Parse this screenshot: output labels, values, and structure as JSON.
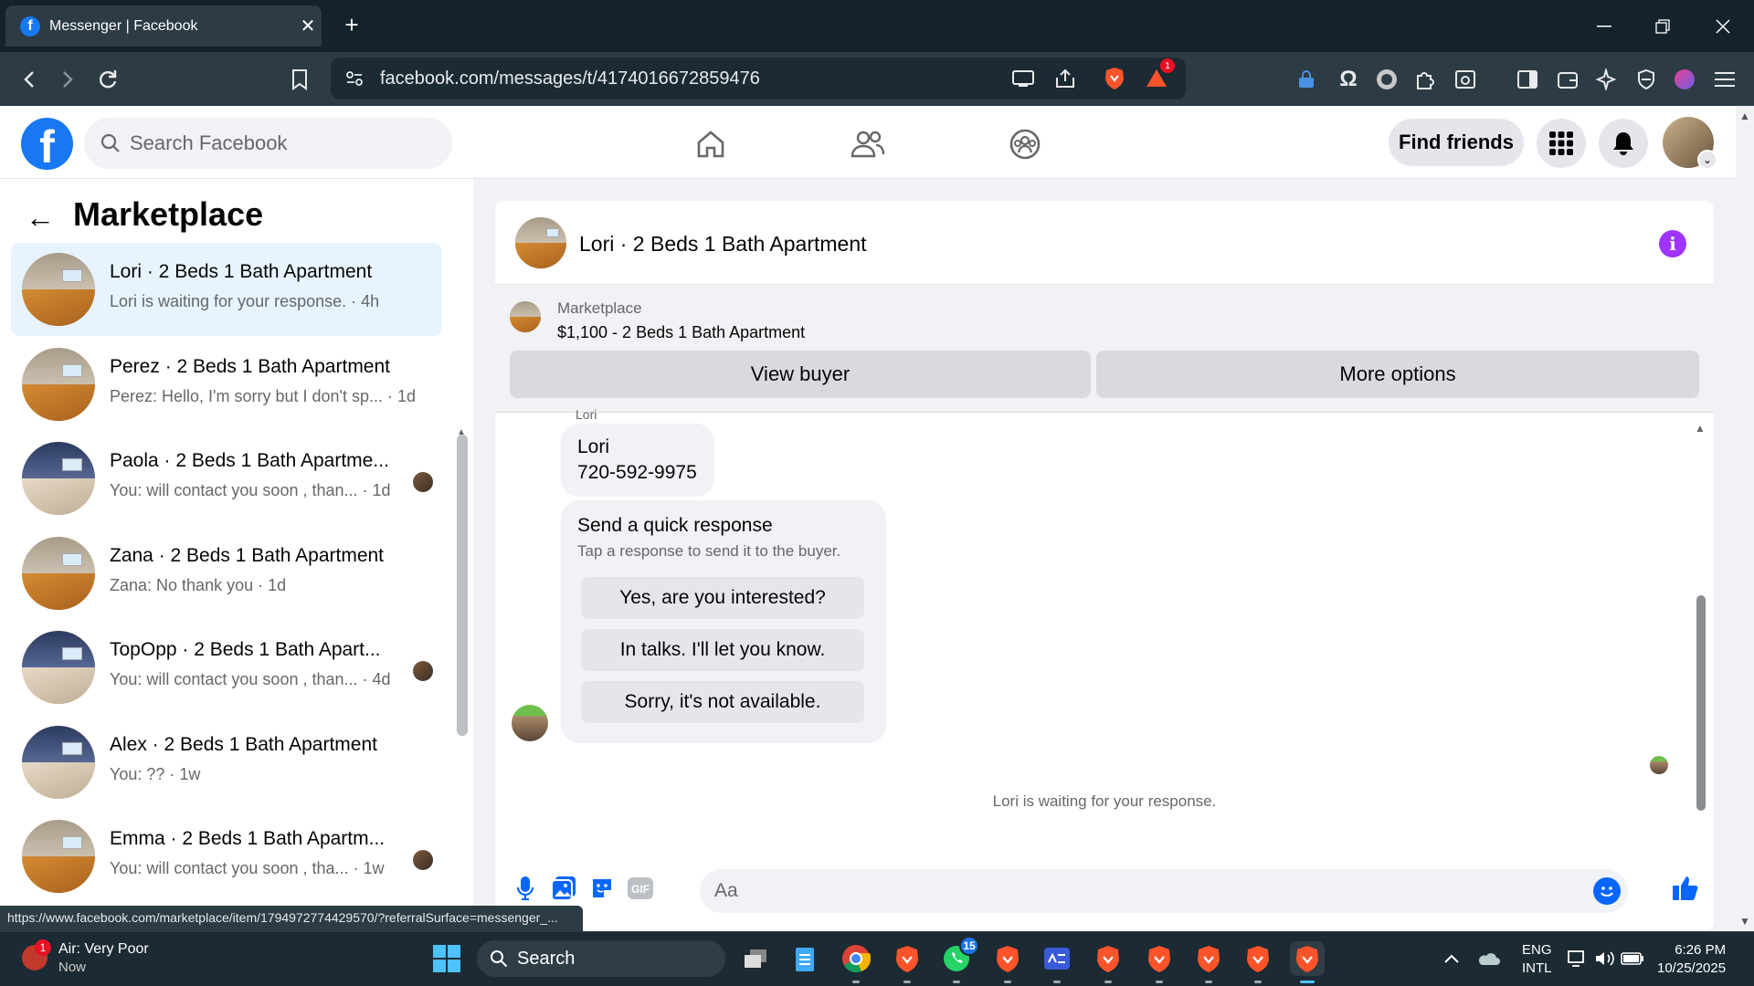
{
  "browser": {
    "tab_title": "Messenger | Facebook",
    "tab_close": "✕",
    "new_tab": "+",
    "url": "facebook.com/messages/t/4174016672859476",
    "brave_alert_count": "1"
  },
  "fb": {
    "logo": "f",
    "search_placeholder": "Search Facebook",
    "find_friends": "Find friends"
  },
  "sidebar": {
    "title": "Marketplace",
    "back": "←",
    "conversations": [
      {
        "name": "Lori · 2 Beds 1 Bath Apartment",
        "preview": "Lori is waiting for your response. · 4h",
        "thumb": "room",
        "active": true
      },
      {
        "name": "Perez · 2 Beds 1 Bath Apartment",
        "preview": "Perez: Hello, I'm sorry but I don't sp... · 1d",
        "thumb": "room"
      },
      {
        "name": "Paola · 2 Beds 1 Bath Apartme...",
        "preview": "You: will contact you soon , than... · 1d",
        "thumb": "bed",
        "seen": true
      },
      {
        "name": "Zana · 2 Beds 1 Bath Apartment",
        "preview": "Zana: No thank you · 1d",
        "thumb": "room"
      },
      {
        "name": "TopOpp · 2 Beds 1 Bath Apart...",
        "preview": "You: will contact you soon , than... · 4d",
        "thumb": "bed",
        "seen": true
      },
      {
        "name": "Alex · 2 Beds 1 Bath Apartment",
        "preview": "You: ?? · 1w",
        "thumb": "bed"
      },
      {
        "name": "Emma · 2 Beds 1 Bath Apartm...",
        "preview": "You: will contact you soon , tha... · 1w",
        "thumb": "room",
        "seen": true
      }
    ]
  },
  "chat": {
    "header_name": "Lori · 2 Beds 1 Bath Apartment",
    "info": "i",
    "marketplace_label": "Marketplace",
    "listing": "$1,100 - 2 Beds 1 Bath Apartment",
    "view_buyer": "View buyer",
    "more_options": "More options",
    "sender_tag": "Lori",
    "contact_name": "Lori",
    "contact_phone": "720-592-9975",
    "quick_title": "Send a quick response",
    "quick_sub": "Tap a response to send it to the buyer.",
    "quick_responses": [
      "Yes, are you interested?",
      "In talks. I'll let you know.",
      "Sorry, it's not available."
    ],
    "waiting": "Lori is waiting for your response.",
    "input_placeholder": "Aa"
  },
  "status_url": "https://www.facebook.com/marketplace/item/1794972774429570/?referralSurface=messenger_...",
  "taskbar": {
    "weather_title": "Air: Very Poor",
    "weather_sub": "Now",
    "weather_badge": "1",
    "search": "Search",
    "whatsapp_count": "15",
    "lang1": "ENG",
    "lang2": "INTL",
    "time": "6:26 PM",
    "date": "10/25/2025"
  },
  "colors": {
    "fb_blue": "#1877f2",
    "messenger_purple": "#a033ff",
    "brave_orange": "#fb542b"
  }
}
